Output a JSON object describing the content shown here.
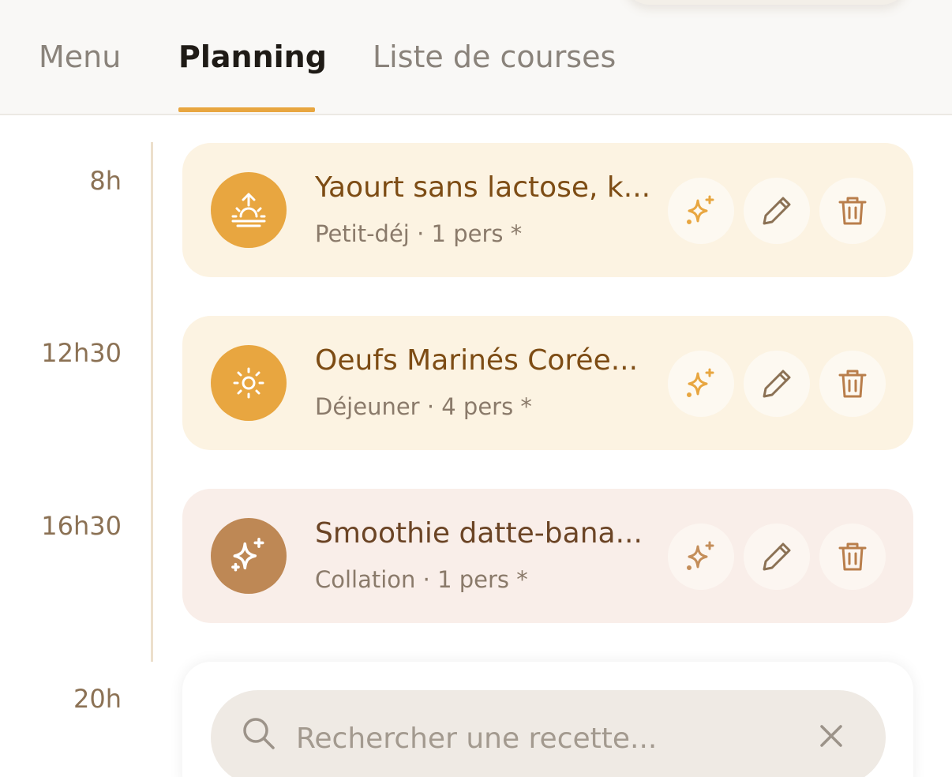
{
  "tabs": [
    {
      "label": "Menu",
      "active": false
    },
    {
      "label": "Planning",
      "active": true
    },
    {
      "label": "Liste de courses",
      "active": false
    }
  ],
  "accent_color": "#e8a640",
  "meals": [
    {
      "time": "8h",
      "title": "Yaourt sans lactose, k...",
      "subtitle": "Petit-déj · 1 pers *",
      "icon": "sunrise-icon"
    },
    {
      "time": "12h30",
      "title": "Oeufs Marinés Corée...",
      "subtitle": "Déjeuner · 4 pers *",
      "icon": "sun-icon"
    },
    {
      "time": "16h30",
      "title": "Smoothie datte-bana...",
      "subtitle": "Collation · 1 pers *",
      "icon": "sparkle-icon"
    }
  ],
  "next_time": "20h",
  "search": {
    "placeholder": "Rechercher une recette...",
    "value": ""
  }
}
